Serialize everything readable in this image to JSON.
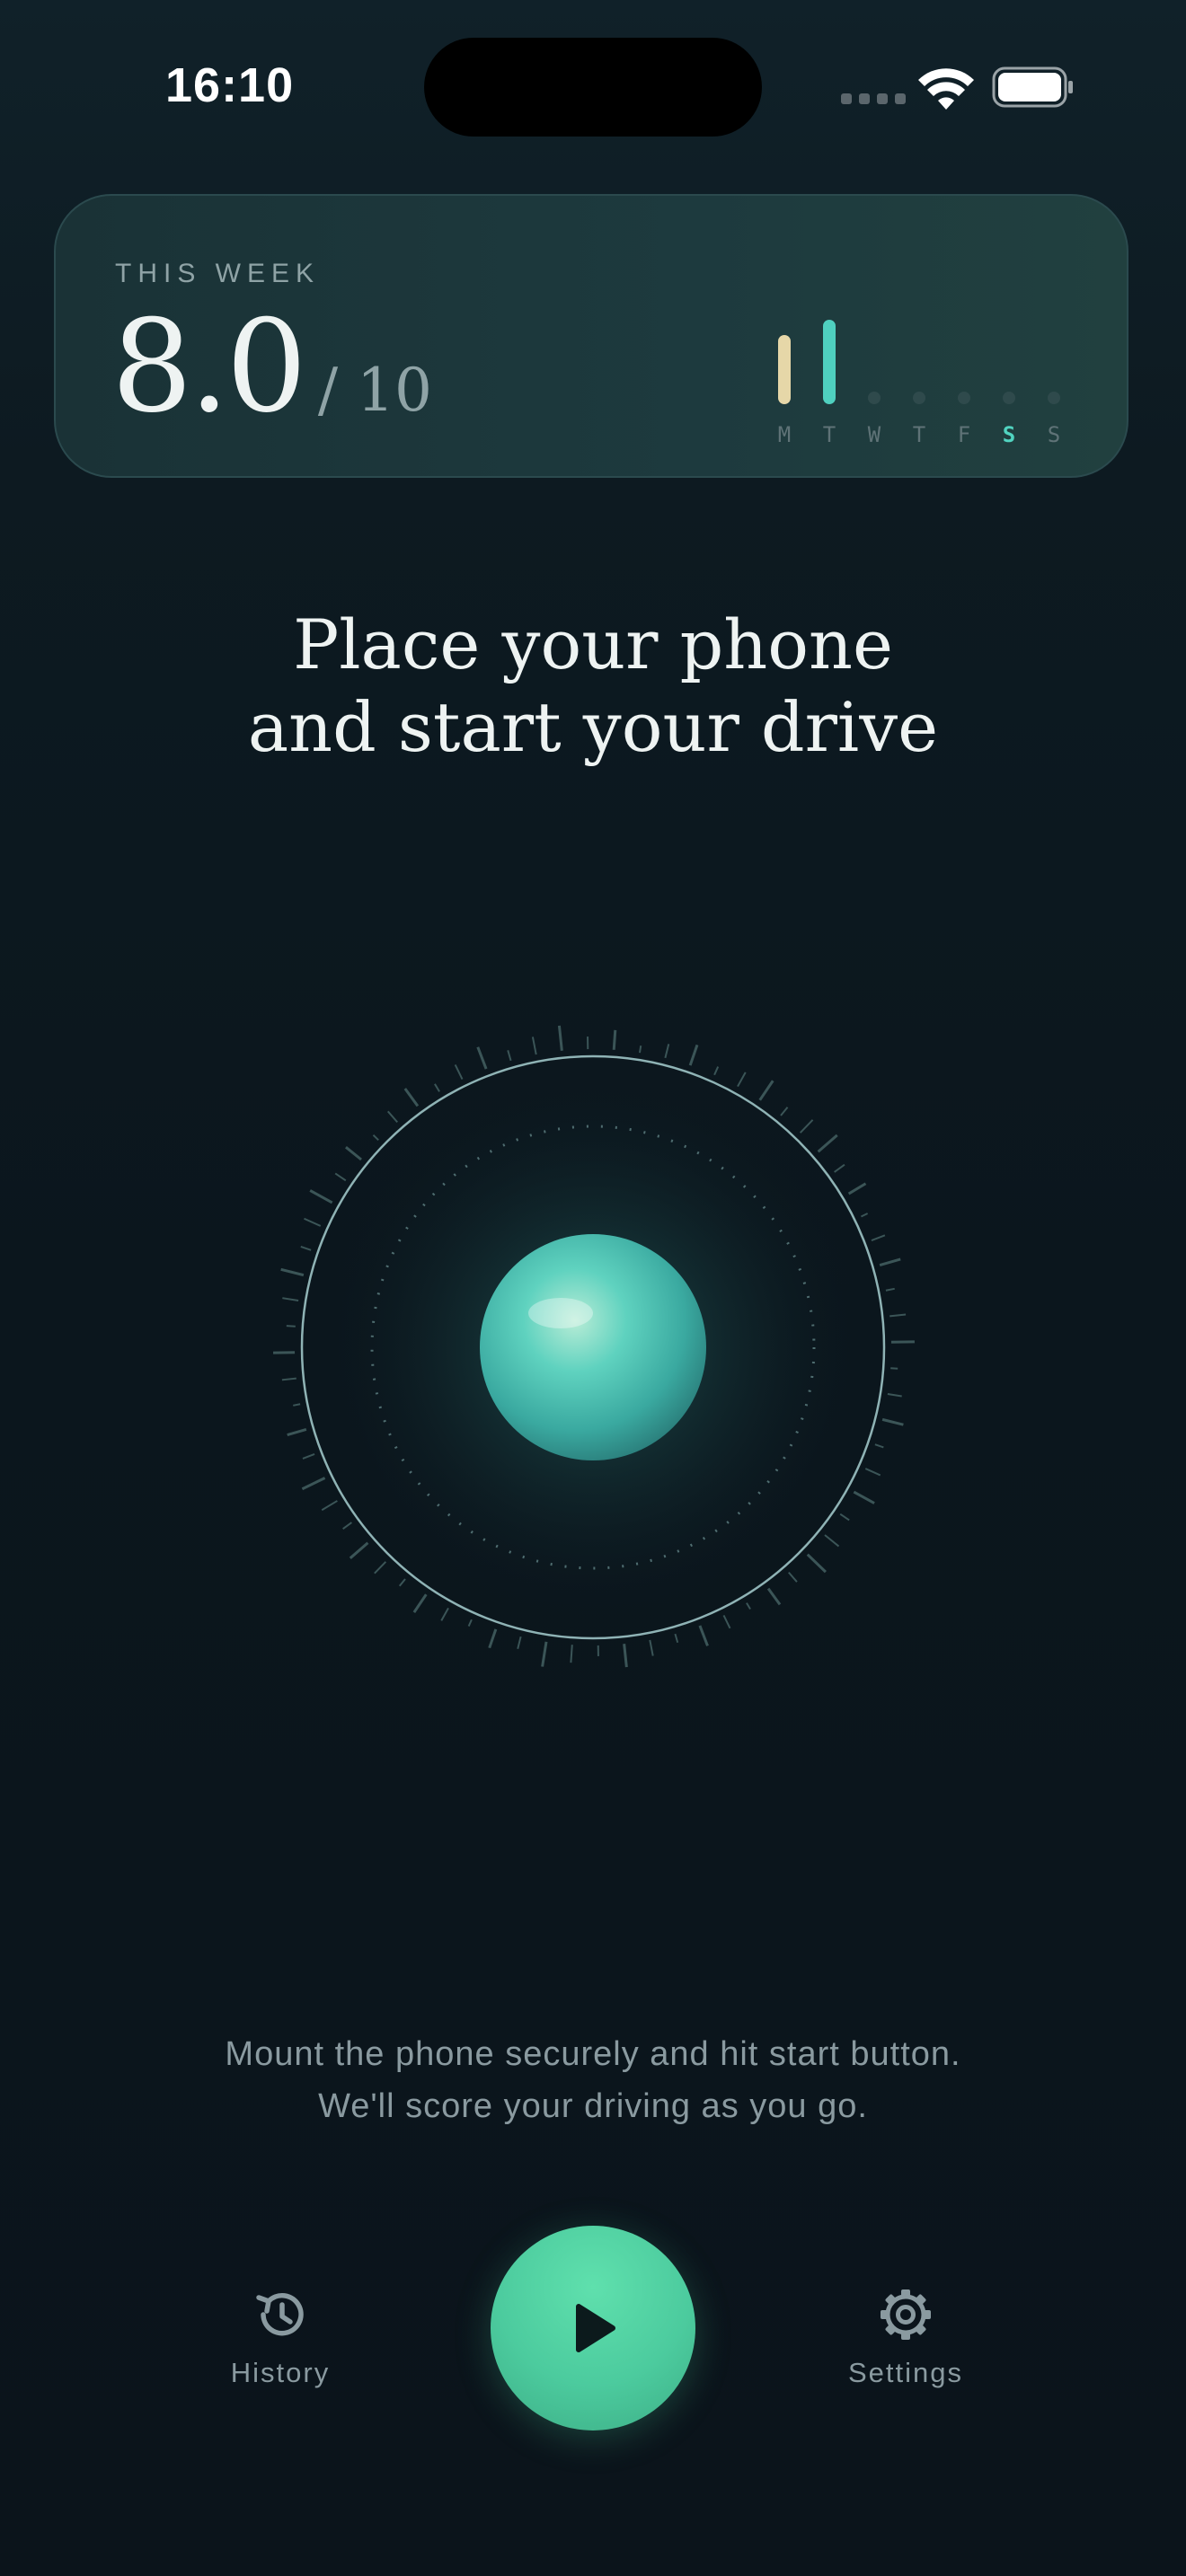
{
  "status_bar": {
    "time": "16:10"
  },
  "week_card": {
    "label": "THIS WEEK",
    "score": "8.0",
    "score_max": "/ 10",
    "days": [
      {
        "label": "M",
        "value": 0.7,
        "color": "#e6d7a8",
        "today": false
      },
      {
        "label": "T",
        "value": 0.85,
        "color": "#4fd0bf",
        "today": false
      },
      {
        "label": "W",
        "value": 0,
        "color": "#2f4a4c",
        "today": false
      },
      {
        "label": "T",
        "value": 0,
        "color": "#2f4a4c",
        "today": false
      },
      {
        "label": "F",
        "value": 0,
        "color": "#2f4a4c",
        "today": false
      },
      {
        "label": "S",
        "value": 0,
        "color": "#2f4a4c",
        "today": true
      },
      {
        "label": "S",
        "value": 0,
        "color": "#2f4a4c",
        "today": false
      }
    ]
  },
  "headline": {
    "line1": "Place your phone",
    "line2": "and start your drive"
  },
  "hint": {
    "line1": "Mount the phone securely and hit start button.",
    "line2": "We'll score your driving as you go."
  },
  "nav": {
    "history_label": "History",
    "settings_label": "Settings",
    "start_icon": "play-icon"
  },
  "colors": {
    "accent": "#4ccb9e",
    "orb": "#4cc3b3",
    "ring": "#8fb3b5"
  }
}
